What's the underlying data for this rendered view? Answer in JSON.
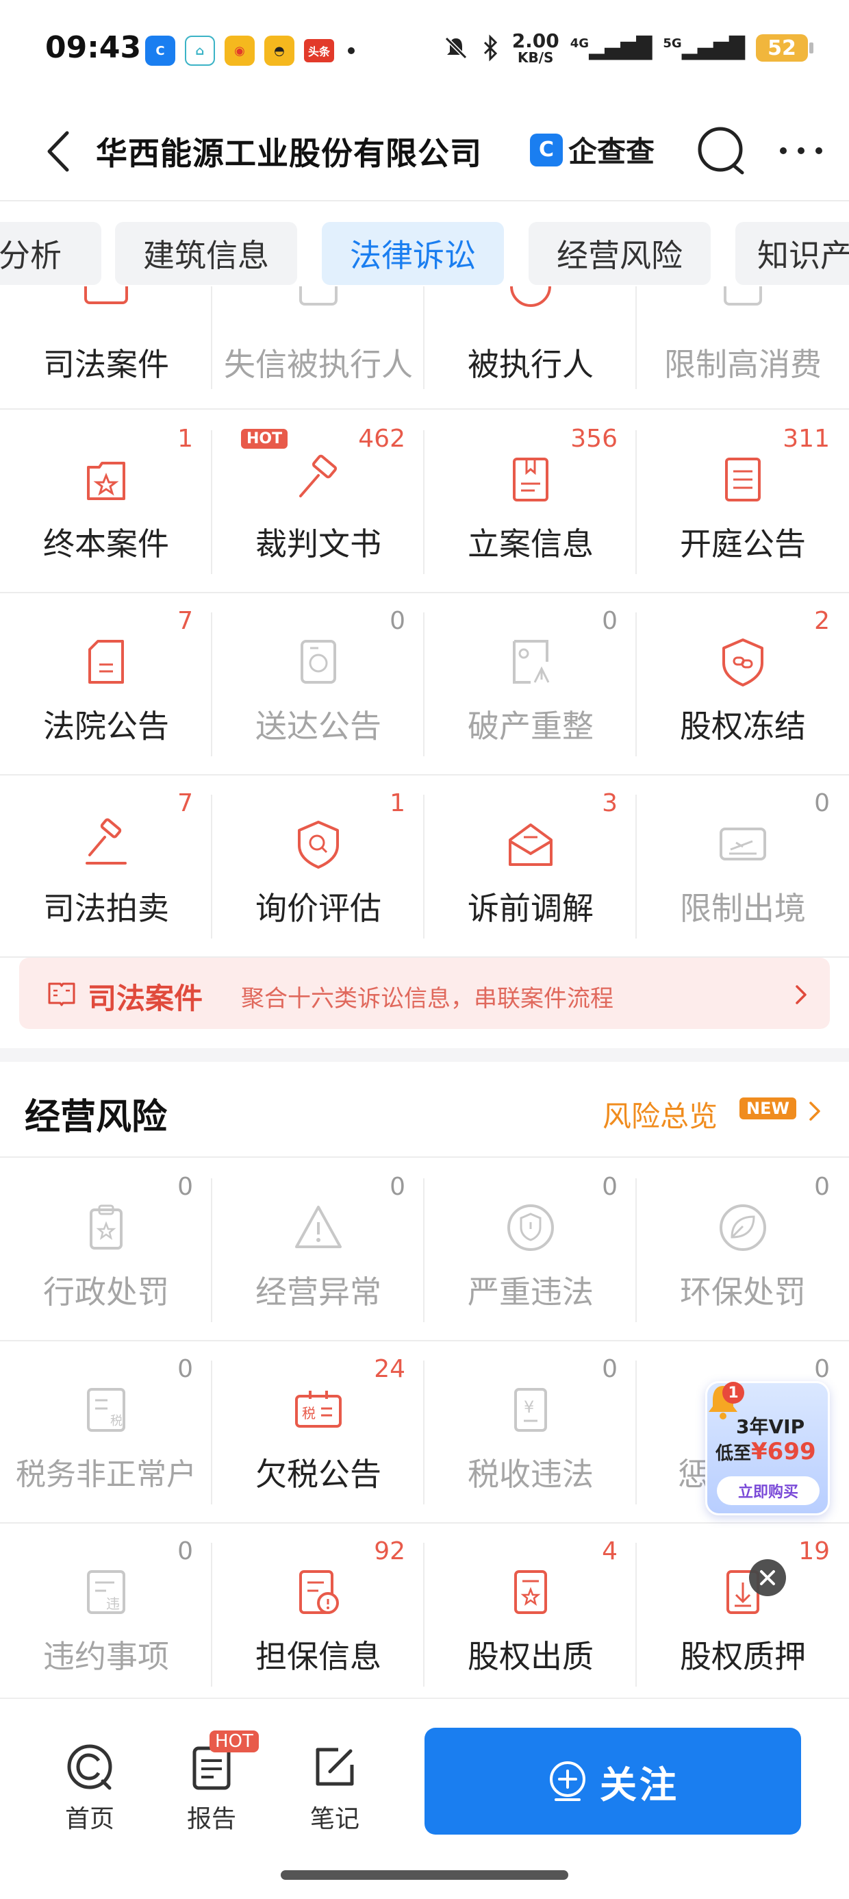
{
  "status_bar": {
    "time": "09:43",
    "speed_value": "2.00",
    "speed_unit": "KB/S",
    "signal1": "4G",
    "signal2": "5G",
    "battery": "52",
    "app_news_label": "头条"
  },
  "nav": {
    "title": "华西能源工业股份有限公司",
    "brand": "企查查"
  },
  "tabs": [
    "分析",
    "建筑信息",
    "法律诉讼",
    "经营风险",
    "知识产"
  ],
  "top_row": [
    "司法案件",
    "失信被执行人",
    "被执行人",
    "限制高消费"
  ],
  "legal_grid": [
    [
      {
        "label": "终本案件",
        "count": "1",
        "icon": "case-icon"
      },
      {
        "label": "裁判文书",
        "count": "462",
        "icon": "gavel-icon",
        "hot": "HOT"
      },
      {
        "label": "立案信息",
        "count": "356",
        "icon": "bookmark-doc-icon"
      },
      {
        "label": "开庭公告",
        "count": "311",
        "icon": "list-doc-icon"
      }
    ],
    [
      {
        "label": "法院公告",
        "count": "7",
        "icon": "court-notice-icon"
      },
      {
        "label": "送达公告",
        "count": "0",
        "icon": "delivery-notice-icon"
      },
      {
        "label": "破产重整",
        "count": "0",
        "icon": "bankruptcy-icon"
      },
      {
        "label": "股权冻结",
        "count": "2",
        "icon": "equity-freeze-icon"
      }
    ],
    [
      {
        "label": "司法拍卖",
        "count": "7",
        "icon": "auction-icon"
      },
      {
        "label": "询价评估",
        "count": "1",
        "icon": "valuation-icon"
      },
      {
        "label": "诉前调解",
        "count": "3",
        "icon": "mediation-icon"
      },
      {
        "label": "限制出境",
        "count": "0",
        "icon": "exit-ban-icon"
      }
    ]
  ],
  "banner": {
    "title": "司法案件",
    "subtitle": "聚合十六类诉讼信息，串联案件流程"
  },
  "risk_section": {
    "title": "经营风险",
    "link": "风险总览",
    "badge": "NEW"
  },
  "risk_grid": [
    [
      {
        "label": "行政处罚",
        "count": "0",
        "icon": "admin-penalty-icon"
      },
      {
        "label": "经营异常",
        "count": "0",
        "icon": "warning-icon"
      },
      {
        "label": "严重违法",
        "count": "0",
        "icon": "shield-alert-icon"
      },
      {
        "label": "环保处罚",
        "count": "0",
        "icon": "leaf-icon"
      }
    ],
    [
      {
        "label": "税务非正常户",
        "count": "0",
        "icon": "tax-abnormal-icon"
      },
      {
        "label": "欠税公告",
        "count": "24",
        "icon": "tax-owed-icon"
      },
      {
        "label": "税收违法",
        "count": "0",
        "icon": "tax-violation-icon"
      },
      {
        "label": "惩",
        "count": "0",
        "icon": "punish-icon"
      }
    ],
    [
      {
        "label": "违约事项",
        "count": "0",
        "icon": "breach-icon"
      },
      {
        "label": "担保信息",
        "count": "92",
        "icon": "guarantee-icon"
      },
      {
        "label": "股权出质",
        "count": "4",
        "icon": "equity-pledge-out-icon"
      },
      {
        "label": "股权质押",
        "count": "19",
        "icon": "equity-pledge-icon"
      }
    ]
  ],
  "vip_promo": {
    "badge": "1",
    "line1": "3年VIP",
    "line2_prefix": "低至",
    "price": "¥699",
    "button": "立即购买"
  },
  "bottom_bar": {
    "home": "首页",
    "report": "报告",
    "report_badge": "HOT",
    "notes": "笔记",
    "follow": "关注"
  },
  "colors": {
    "accent_blue": "#1a7ef0",
    "accent_red": "#e85a4a",
    "accent_orange": "#f08c1e",
    "muted_gray": "#a5a5a5"
  }
}
